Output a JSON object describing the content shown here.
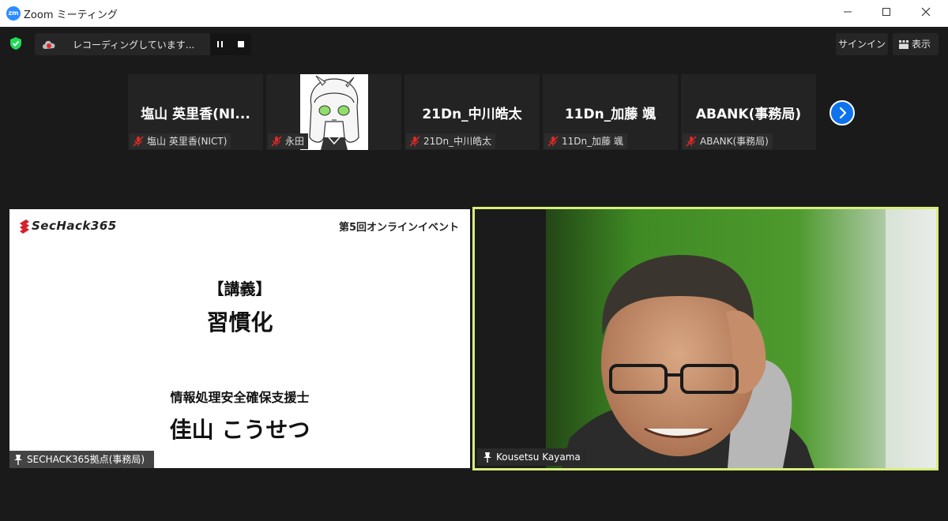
{
  "window": {
    "title": "Zoom ミーティング",
    "logo_text": "zm"
  },
  "recording": {
    "label": "レコーディングしています..."
  },
  "toolbar": {
    "signin_label": "サインイン",
    "view_label": "表示"
  },
  "gallery": {
    "tiles": [
      {
        "display_name": "塩山 英里香(NI...",
        "caption": "塩山 英里香(NICT)",
        "has_avatar": false
      },
      {
        "display_name": "",
        "caption": "永田",
        "has_avatar": true
      },
      {
        "display_name": "21Dn_中川皓太",
        "caption": "21Dn_中川皓太",
        "has_avatar": false
      },
      {
        "display_name": "11Dn_加藤 颯",
        "caption": "11Dn_加藤 颯",
        "has_avatar": false
      },
      {
        "display_name": "ABANK(事務局)",
        "caption": "ABANK(事務局)",
        "has_avatar": false
      }
    ]
  },
  "share": {
    "logo": "SecHack365",
    "event": "第5回オンラインイベント",
    "lecture_tag": "【講義】",
    "lecture_title": "習慣化",
    "speaker_role": "情報処理安全確保支援士",
    "speaker_name": "佳山 こうせつ",
    "presenter_caption": "SECHACK365拠点(事務局)"
  },
  "speaker": {
    "name": "Kousetsu Kayama",
    "highlight_color": "#d7ee7e"
  },
  "colors": {
    "accent": "#0e72ed",
    "muted": "#e02828"
  }
}
